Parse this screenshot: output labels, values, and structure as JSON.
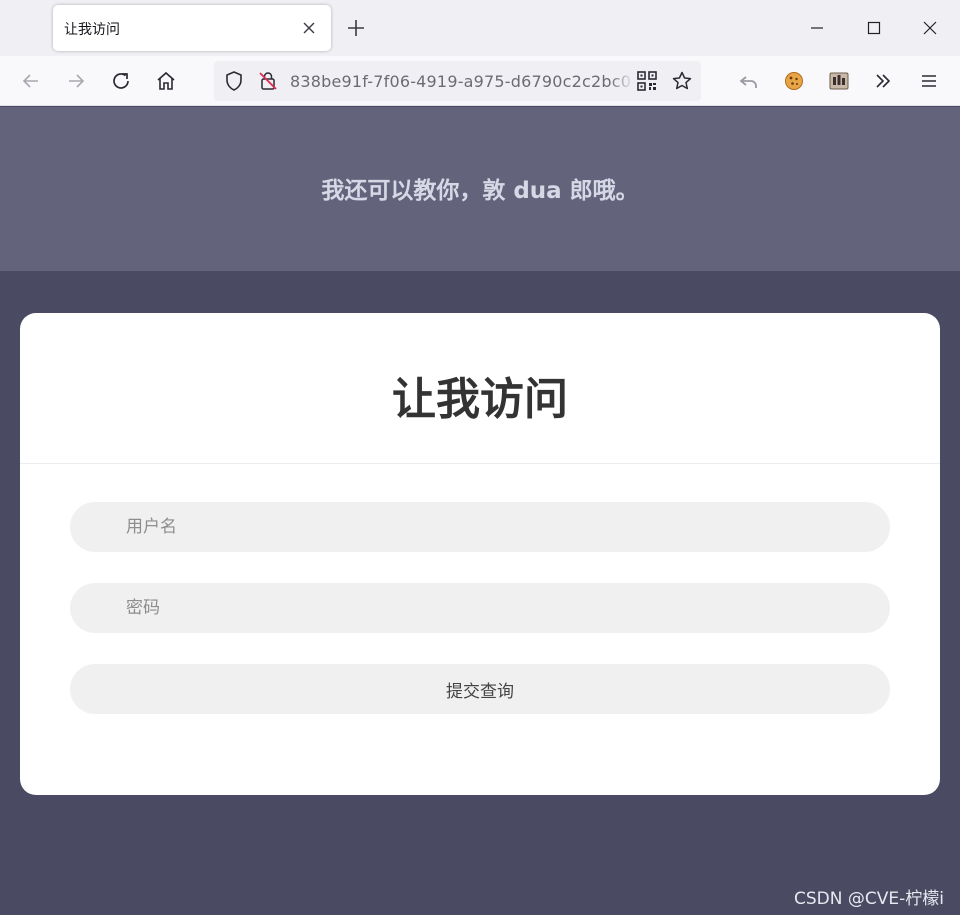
{
  "browser": {
    "tab_title": "让我访问",
    "url": "838be91f-7f06-4919-a975-d6790c2c2bc0"
  },
  "page": {
    "banner_text": "我还可以教你，敦 dua 郎哦。",
    "card_title": "让我访问",
    "form": {
      "username_placeholder": "用户名",
      "password_placeholder": "密码",
      "submit_label": "提交查询"
    }
  },
  "watermark": "CSDN @CVE-柠檬i",
  "colors": {
    "chrome_tabbar": "#f0f0f4",
    "chrome_navbar": "#f9f9fb",
    "banner": "#63647c",
    "page_background": "#4a4b63",
    "card": "#ffffff",
    "field": "#f0f0f0"
  }
}
